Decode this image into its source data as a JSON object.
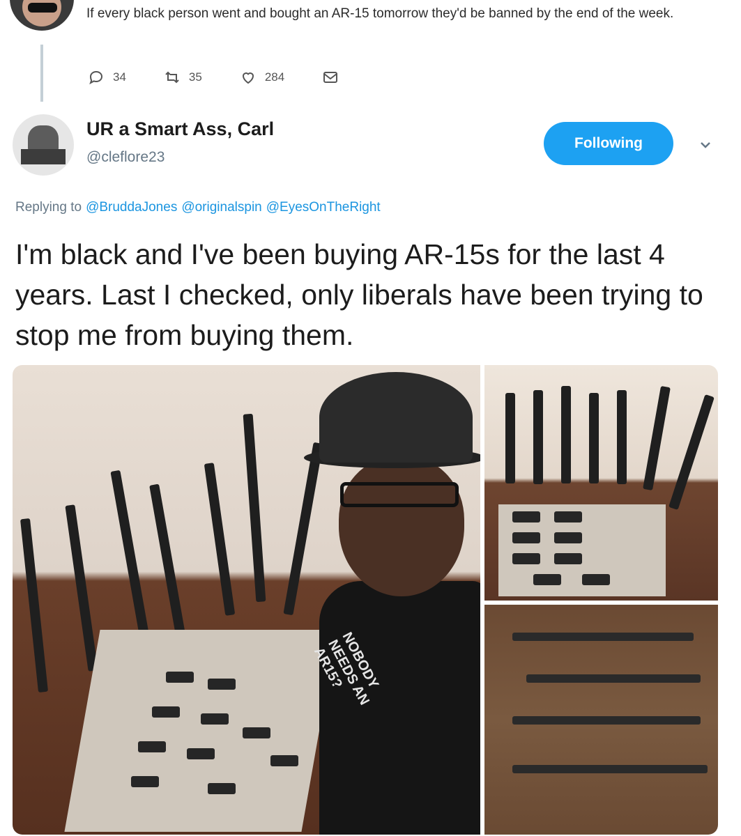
{
  "parent_tweet": {
    "text": "If every black person went and bought an AR-15 tomorrow they'd be banned by the end of the week.",
    "actions": {
      "replies": "34",
      "retweets": "35",
      "likes": "284"
    }
  },
  "reply_tweet": {
    "display_name": "UR a Smart Ass, Carl",
    "handle": "@cleflore23",
    "follow_label": "Following",
    "replying_prefix": "Replying to",
    "replying_to": [
      "@BruddaJones",
      "@originalspin",
      "@EyesOnTheRight"
    ],
    "body": "I'm black and I've been buying AR-15s for the last 4 years. Last I checked, only liberals have been trying to stop me from buying them.",
    "shirt_text": "NOBODY NEEDS AN AR15?"
  },
  "colors": {
    "accent": "#1da1f2",
    "mention": "#1b95e0",
    "muted": "#657786"
  }
}
